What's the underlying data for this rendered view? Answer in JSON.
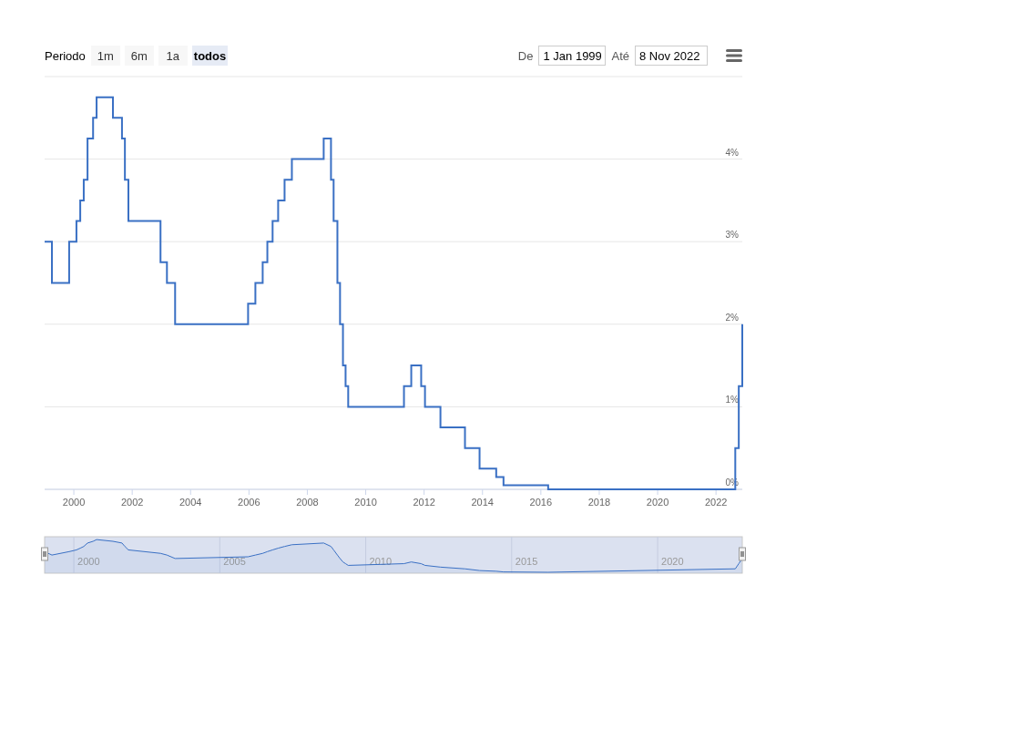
{
  "range_selector": {
    "label": "Periodo",
    "buttons": [
      {
        "label": "1m",
        "selected": false
      },
      {
        "label": "6m",
        "selected": false
      },
      {
        "label": "1a",
        "selected": false
      },
      {
        "label": "todos",
        "selected": true
      }
    ]
  },
  "date_inputs": {
    "from_label": "De",
    "from_value": "1 Jan 1999",
    "to_label": "Até",
    "to_value": "8 Nov 2022"
  },
  "chart_data": {
    "type": "line",
    "grid": true,
    "x": [
      1999.0,
      1999.25,
      1999.25,
      1999.84,
      1999.84,
      2000.09,
      2000.09,
      2000.22,
      2000.22,
      2000.34,
      2000.34,
      2000.47,
      2000.47,
      2000.66,
      2000.66,
      2000.78,
      2000.78,
      2001.34,
      2001.34,
      2001.65,
      2001.65,
      2001.75,
      2001.75,
      2001.87,
      2001.87,
      2002.97,
      2002.97,
      2003.19,
      2003.19,
      2003.47,
      2003.47,
      2005.97,
      2005.97,
      2006.22,
      2006.22,
      2006.47,
      2006.47,
      2006.63,
      2006.63,
      2006.81,
      2006.81,
      2007.0,
      2007.0,
      2007.22,
      2007.22,
      2007.47,
      2007.47,
      2008.56,
      2008.56,
      2008.81,
      2008.81,
      2008.9,
      2008.9,
      2009.03,
      2009.03,
      2009.12,
      2009.12,
      2009.22,
      2009.22,
      2009.31,
      2009.31,
      2009.4,
      2009.4,
      2011.31,
      2011.31,
      2011.56,
      2011.56,
      2011.9,
      2011.9,
      2012.03,
      2012.03,
      2012.56,
      2012.56,
      2013.4,
      2013.4,
      2013.9,
      2013.9,
      2014.47,
      2014.47,
      2014.72,
      2014.72,
      2016.25,
      2016.25,
      2022.66,
      2022.66,
      2022.78,
      2022.78,
      2022.9,
      2022.9
    ],
    "series": [
      {
        "color": "#3a70c4",
        "values": [
          3,
          3,
          2.5,
          2.5,
          3,
          3,
          3.25,
          3.25,
          3.5,
          3.5,
          3.75,
          3.75,
          4.25,
          4.25,
          4.5,
          4.5,
          4.75,
          4.75,
          4.5,
          4.5,
          4.25,
          4.25,
          3.75,
          3.75,
          3.25,
          3.25,
          2.75,
          2.75,
          2.5,
          2.5,
          2,
          2,
          2.25,
          2.25,
          2.5,
          2.5,
          2.75,
          2.75,
          3,
          3,
          3.25,
          3.25,
          3.5,
          3.5,
          3.75,
          3.75,
          4,
          4,
          4.25,
          4.25,
          3.75,
          3.75,
          3.25,
          3.25,
          2.5,
          2.5,
          2,
          2,
          1.5,
          1.5,
          1.25,
          1.25,
          1,
          1,
          1.25,
          1.25,
          1.5,
          1.5,
          1.25,
          1.25,
          1,
          1,
          0.75,
          0.75,
          0.5,
          0.5,
          0.25,
          0.25,
          0.15,
          0.15,
          0.05,
          0.05,
          0,
          0,
          0.5,
          0.5,
          1.25,
          1.25,
          2
        ]
      }
    ],
    "xlim": [
      1999,
      2022.9
    ],
    "ylim": [
      0,
      5
    ],
    "xticks": [
      {
        "value": 2000,
        "label": "2000"
      },
      {
        "value": 2002,
        "label": "2002"
      },
      {
        "value": 2004,
        "label": "2004"
      },
      {
        "value": 2006,
        "label": "2006"
      },
      {
        "value": 2008,
        "label": "2008"
      },
      {
        "value": 2010,
        "label": "2010"
      },
      {
        "value": 2012,
        "label": "2012"
      },
      {
        "value": 2014,
        "label": "2014"
      },
      {
        "value": 2016,
        "label": "2016"
      },
      {
        "value": 2018,
        "label": "2018"
      },
      {
        "value": 2020,
        "label": "2020"
      },
      {
        "value": 2022,
        "label": "2022"
      }
    ],
    "yticks": [
      {
        "value": 0,
        "label": "0%"
      },
      {
        "value": 1,
        "label": "1%"
      },
      {
        "value": 2,
        "label": "2%"
      },
      {
        "value": 3,
        "label": "3%"
      },
      {
        "value": 4,
        "label": "4%"
      }
    ]
  },
  "navigator": {
    "labels": [
      "2000",
      "2005",
      "2010",
      "2015",
      "2020"
    ]
  }
}
